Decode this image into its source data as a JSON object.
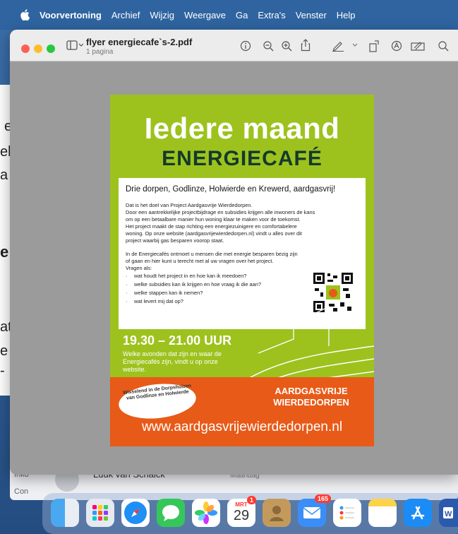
{
  "menubar": {
    "items": [
      "Voorvertoning",
      "Archief",
      "Wijzig",
      "Weergave",
      "Ga",
      "Extra's",
      "Venster",
      "Help"
    ]
  },
  "window": {
    "doc_title": "flyer energiecafe`s-2.pdf",
    "doc_subtitle": "1 pagina"
  },
  "flyer": {
    "title1": "Iedere maand",
    "title2": "ENERGIECAFÉ",
    "headline": "Drie dorpen, Godlinze, Holwierde en Krewerd, aardgasvrij!",
    "para1": [
      "Dat is het doel van Project Aardgasvrije Wierdedorpen.",
      "Door een aantrekkelijke projectbijdrage en subsidies krijgen alle inwoners de kans",
      "om op een betaalbare manier hun woning klaar te maken voor de toekomst.",
      "Het project maakt de stap richting een energiezuinigere en comfortabelere",
      "woning. Op onze website (aardgasvrijewierdedorpen.nl) vindt u alles over dit",
      "project waarbij gas besparen voorop staat."
    ],
    "para2": [
      "In de Energiecafés ontmoet u mensen die met energie besparen bezig zijn",
      "of gaan en hier kunt u terecht met al uw vragen over het project.",
      "Vragen als:"
    ],
    "questions": [
      "wat houdt het project in en hoe kan ik meedoen?",
      "welke subsidies kan ik krijgen en hoe vraag ik die aan?",
      "welke stappen kan ik nemen?",
      "wat levert mij dat op?"
    ],
    "time": "19.30 – 21.00 UUR",
    "time_note": "Welke avonden dat zijn en waar de Energiecafés zijn, vindt u op onze website.",
    "oval_text": "Wisselend in de Dorpshuizen van Godlinze en Holwierde",
    "brand": "AARDGASVRIJE WIERDEDORPEN",
    "url": "www.aardgasvrijewierdedorpen.nl"
  },
  "mail": {
    "sender": "Luuk van Schaick",
    "date": "Maandag",
    "folder1": "Inko",
    "folder2": "Con"
  },
  "dock": {
    "calendar_month": "MRT",
    "calendar_day": "29",
    "calendar_badge": "1",
    "mail_badge": "165"
  },
  "colors": {
    "flyer_green": "#9dc21e",
    "flyer_orange": "#e85a18",
    "flyer_dark": "#133a2b"
  },
  "bg_fragments": [
    "e",
    "eb",
    "a",
    "e",
    "at",
    "e",
    "-"
  ]
}
